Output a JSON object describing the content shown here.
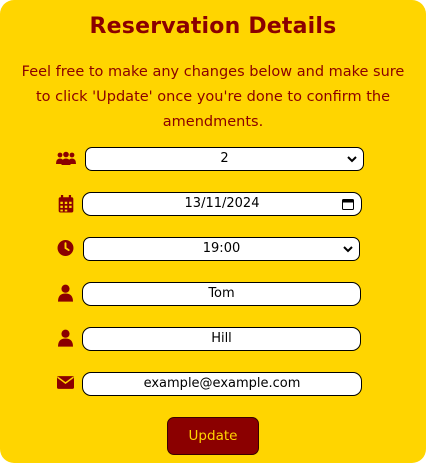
{
  "form": {
    "title": "Reservation Details",
    "intro": "Feel free to make any changes below and make sure to click 'Update' once you're done to confirm the amendments.",
    "guests": {
      "value": "2",
      "icon": "group-icon"
    },
    "date": {
      "value": "13/11/2024",
      "icon": "calendar-icon"
    },
    "time": {
      "value": "19:00",
      "icon": "clock-icon"
    },
    "first_name": {
      "value": "Tom",
      "icon": "user-icon"
    },
    "last_name": {
      "value": "Hill",
      "icon": "user-icon"
    },
    "email": {
      "value": "example@example.com",
      "icon": "envelope-icon"
    },
    "update_label": "Update"
  },
  "colors": {
    "background": "#ffd500",
    "accent": "#8b0000"
  }
}
